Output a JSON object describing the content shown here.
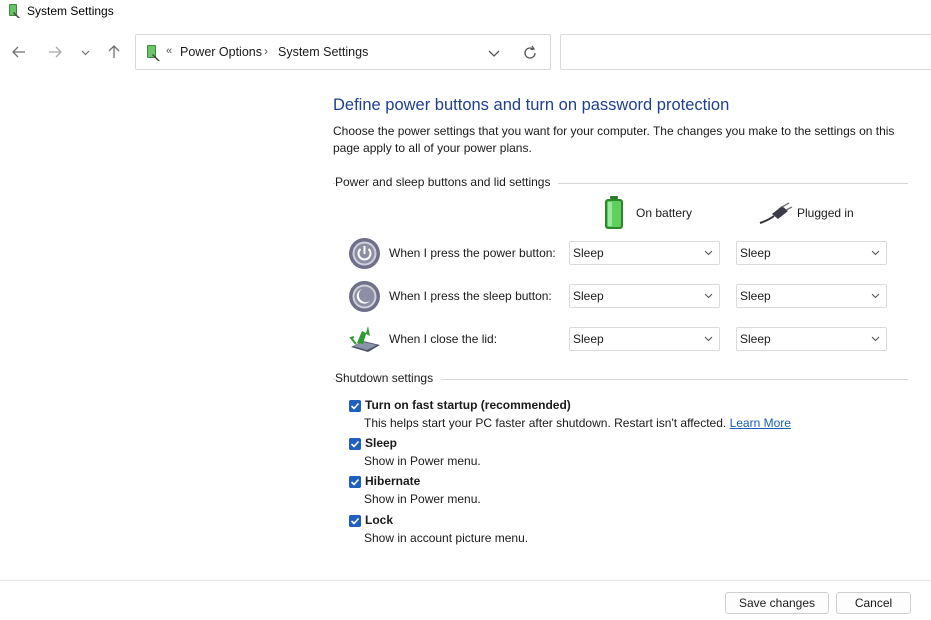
{
  "window": {
    "title": "System Settings"
  },
  "nav": {
    "back_icon": "arrow-left-icon",
    "forward_icon": "arrow-right-icon",
    "recent_icon": "chevron-down-icon",
    "up_icon": "arrow-up-icon",
    "breadcrumbs": [
      "Power Options",
      "System Settings"
    ],
    "search_placeholder": ""
  },
  "page": {
    "title": "Define power buttons and turn on password protection",
    "intro": "Choose the power settings that you want for your computer. The changes you make to the settings on this page apply to all of your power plans."
  },
  "buttons_section": {
    "header": "Power and sleep buttons and lid settings",
    "columns": {
      "battery": "On battery",
      "plugged": "Plugged in"
    },
    "rows": [
      {
        "label": "When I press the power button:",
        "battery": "Sleep",
        "plugged": "Sleep",
        "icon": "power-button-icon"
      },
      {
        "label": "When I press the sleep button:",
        "battery": "Sleep",
        "plugged": "Sleep",
        "icon": "sleep-button-icon"
      },
      {
        "label": "When I close the lid:",
        "battery": "Sleep",
        "plugged": "Sleep",
        "icon": "laptop-lid-icon"
      }
    ]
  },
  "shutdown_section": {
    "header": "Shutdown settings",
    "items": [
      {
        "label": "Turn on fast startup (recommended)",
        "desc": "This helps start your PC faster after shutdown. Restart isn't affected. ",
        "link": "Learn More",
        "checked": true
      },
      {
        "label": "Sleep",
        "desc": "Show in Power menu.",
        "checked": true
      },
      {
        "label": "Hibernate",
        "desc": "Show in Power menu.",
        "checked": true
      },
      {
        "label": "Lock",
        "desc": "Show in account picture menu.",
        "checked": true
      }
    ]
  },
  "footer": {
    "save": "Save changes",
    "cancel": "Cancel"
  },
  "colors": {
    "accent": "#1f5fbf",
    "title": "#1f3f8f",
    "link": "#1a5fb4"
  }
}
